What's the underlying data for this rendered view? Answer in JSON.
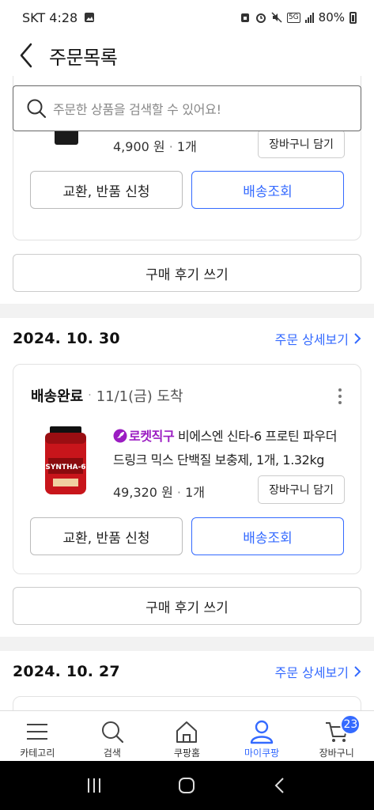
{
  "status_bar": {
    "carrier_time": "SKT 4:28",
    "network": "5G",
    "battery": "80%"
  },
  "header": {
    "title": "주문목록"
  },
  "search": {
    "placeholder": "주문한 상품을 검색할 수 있어요!"
  },
  "order1_partial": {
    "price": "4,900 원",
    "qty": "1개",
    "cart_button": "장바구니 담기",
    "exchange_button": "교환, 반품 신청",
    "track_button": "배송조회",
    "review_button": "구매 후기 쓰기"
  },
  "order2": {
    "date": "2024. 10. 30",
    "detail_link": "주문 상세보기",
    "status": "배송완료",
    "arrival": "11/1(금) 도착",
    "badge": "로켓직구",
    "product_name": "비에스엔 신타-6 프로틴 파우더 드링크 믹스 단백질 보충제, 1개, 1.32kg",
    "product_image_label": "SYNTHA-6",
    "price": "49,320 원",
    "qty": "1개",
    "cart_button": "장바구니 담기",
    "exchange_button": "교환, 반품 신청",
    "track_button": "배송조회",
    "review_button": "구매 후기 쓰기"
  },
  "order3": {
    "date": "2024. 10. 27",
    "detail_link": "주문 상세보기"
  },
  "bottom_nav": {
    "items": [
      {
        "label": "카테고리",
        "icon": "menu-icon"
      },
      {
        "label": "검색",
        "icon": "search-icon"
      },
      {
        "label": "쿠팡홈",
        "icon": "home-icon"
      },
      {
        "label": "마이쿠팡",
        "icon": "user-icon"
      },
      {
        "label": "장바구니",
        "icon": "cart-icon"
      }
    ],
    "active": "마이쿠팡",
    "cart_count": "23"
  },
  "colors": {
    "accent": "#346aff",
    "rocket": "#9b1cc2",
    "divider": "#f2f2f2"
  }
}
